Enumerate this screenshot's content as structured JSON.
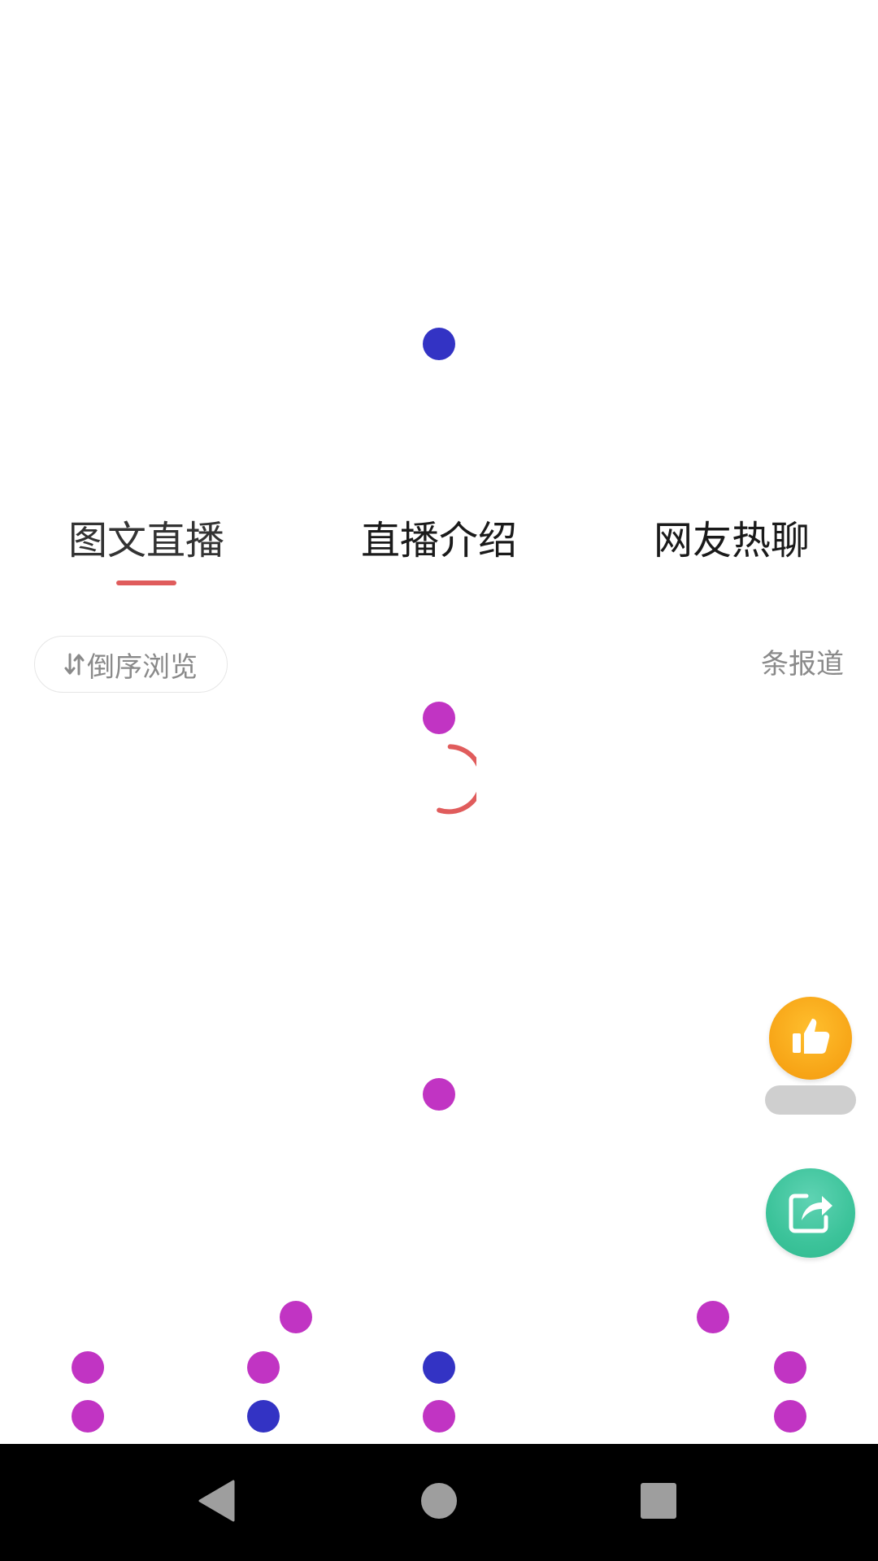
{
  "tabs": [
    {
      "label": "图文直播",
      "active": true
    },
    {
      "label": "直播介绍",
      "active": false
    },
    {
      "label": "网友热聊",
      "active": false
    }
  ],
  "toolbar": {
    "sort_label": "倒序浏览",
    "report_count": "条报道"
  },
  "floating": {
    "like_icon": "thumbs-up-icon",
    "share_icon": "share-icon",
    "like_color": "#f7a416",
    "share_color": "#3cc39a"
  },
  "navigation": {
    "back_icon": "back-triangle-icon",
    "home_icon": "home-circle-icon",
    "recents_icon": "recents-square-icon"
  },
  "colors": {
    "accent": "#e05c5c",
    "dot_blue": "#3333c4",
    "dot_magenta": "#c134c3"
  }
}
